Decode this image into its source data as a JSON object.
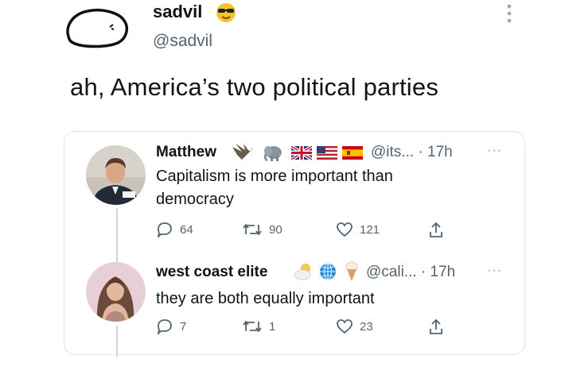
{
  "tweet": {
    "display_name": "sadvil",
    "handle": "@sadvil",
    "text": "ah, America’s two political parties",
    "more": "⋮"
  },
  "replies": [
    {
      "name": "Matthew",
      "handle_time": "@its... · 17h",
      "text_line1": "Capitalism is more important than",
      "text_line2": "democracy",
      "replies": "64",
      "retweets": "90",
      "likes": "121",
      "more": "···"
    },
    {
      "name": "west coast elite",
      "handle_time": "@cali... · 17h",
      "text_line1": "they are both equally important",
      "replies": "7",
      "retweets": "1",
      "likes": "23",
      "more": "···"
    }
  ],
  "icons": {
    "verified": "sunglasses-emoji-icon",
    "reply": "comment-icon",
    "retweet": "retweet-icon",
    "like": "heart-icon",
    "share": "share-icon"
  }
}
